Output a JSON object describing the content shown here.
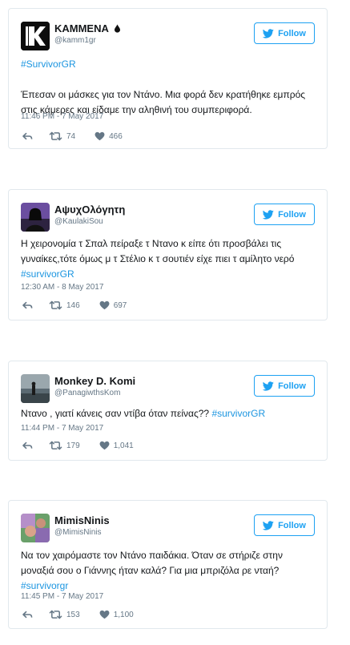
{
  "colors": {
    "accent": "#1da1f2",
    "link": "#1b95e0",
    "muted": "#657786",
    "border": "#e1e8ed"
  },
  "tweets": [
    {
      "name": "KAMMENA",
      "name_suffix_icon": "drop-icon",
      "handle": "@kamm1gr",
      "follow_label": "Follow",
      "hashtag_line": "#SurvivorGR",
      "text": "Έπεσαν οι μάσκες για τον Ντάνο. Μια φορά δεν κρατήθηκε εμπρός στις κάμερες και είδαμε την αληθινή του συμπεριφορά.",
      "timestamp": "11:46 PM - 7 May 2017",
      "retweets": "74",
      "likes": "466"
    },
    {
      "name": "ΑψυχΟλόγητη",
      "handle": "@KaulakiSou",
      "follow_label": "Follow",
      "text": "Η χειρονομία τ Σπαλ πείραξε τ Ντανο κ είπε ότι προσβάλει τις γυναίκες,τότε όμως μ τ Στέλιο κ τ σουτιέν είχε πιει τ αμίλητο νερό",
      "hashtag": "#survivorGR",
      "timestamp": "12:30 AM - 8 May 2017",
      "retweets": "146",
      "likes": "697"
    },
    {
      "name": "Monkey D. Komi",
      "handle": "@PanagiwthsKom",
      "follow_label": "Follow",
      "text": "Ντανο , γιατί κάνεις σαν ντίβα όταν πείνας??",
      "hashtag": "#survivorGR",
      "timestamp": "11:44 PM - 7 May 2017",
      "retweets": "179",
      "likes": "1,041"
    },
    {
      "name": "MimisNinis",
      "handle": "@MimisNinis",
      "follow_label": "Follow",
      "text": "Να τον χαιρόμαστε τον Ντάνο παιδάκια. Όταν σε στήριζε στην μοναξιά σου ο Γιάννης ήταν καλά? Για μια μπριζόλα ρε νταή?",
      "hashtag": "#survivorgr",
      "timestamp": "11:45 PM - 7 May 2017",
      "retweets": "153",
      "likes": "1,100"
    }
  ]
}
